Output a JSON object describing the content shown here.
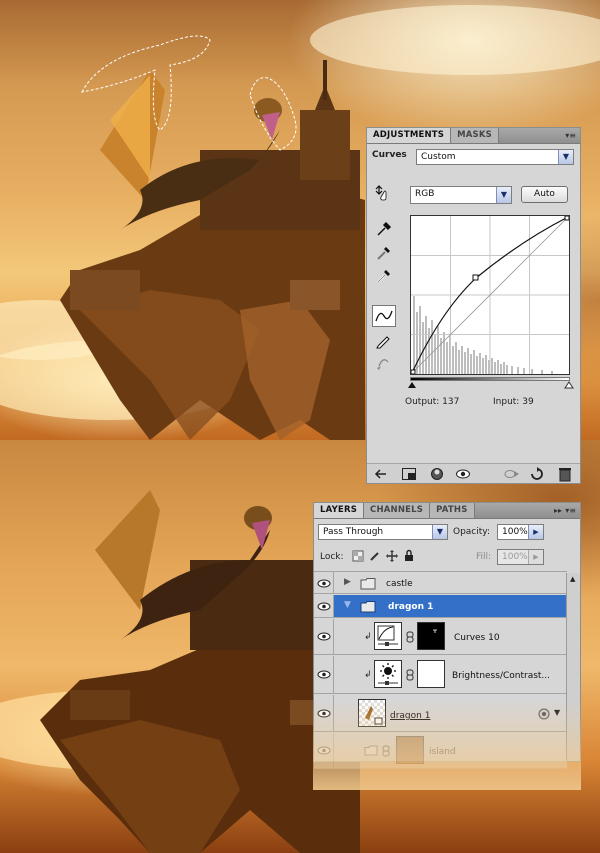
{
  "adjustments": {
    "tabs": [
      "ADJUSTMENTS",
      "MASKS"
    ],
    "type_label": "Curves",
    "preset_value": "Custom",
    "channel_value": "RGB",
    "auto_label": "Auto",
    "output_label": "Output:",
    "output_value": "137",
    "input_label": "Input:",
    "input_value": "39",
    "tools": [
      "on-image-adjust-icon",
      "black-point-eyedropper-icon",
      "gray-point-eyedropper-icon",
      "white-point-eyedropper-icon",
      "curve-points-icon",
      "pencil-draw-icon",
      "smooth-icon"
    ],
    "bottom_icons": [
      "back-arrow-icon",
      "expanded-view-icon",
      "clip-to-layer-icon",
      "visibility-eye-icon",
      "previous-state-icon",
      "reset-icon",
      "trash-icon"
    ]
  },
  "layers": {
    "tabs": [
      "LAYERS",
      "CHANNELS",
      "PATHS"
    ],
    "blend_mode": "Pass Through",
    "opacity_label": "Opacity:",
    "opacity_value": "100%",
    "lock_label": "Lock:",
    "fill_label": "Fill:",
    "fill_value": "100%",
    "rows": [
      {
        "name": "castle",
        "kind": "group",
        "expanded": false,
        "selected": false
      },
      {
        "name": "dragon 1",
        "kind": "group",
        "expanded": true,
        "selected": true
      },
      {
        "name": "Curves 10",
        "kind": "adjustment",
        "clipped": true
      },
      {
        "name": "Brightness/Contrast...",
        "kind": "adjustment",
        "clipped": true
      },
      {
        "name": "dragon 1",
        "kind": "smart-object"
      },
      {
        "name": "island",
        "kind": "layer"
      }
    ]
  },
  "colors": {
    "panel_bg": "#d6d6d6",
    "selected_row": "#3470c8",
    "tab_bar": "#9a9a9a"
  }
}
